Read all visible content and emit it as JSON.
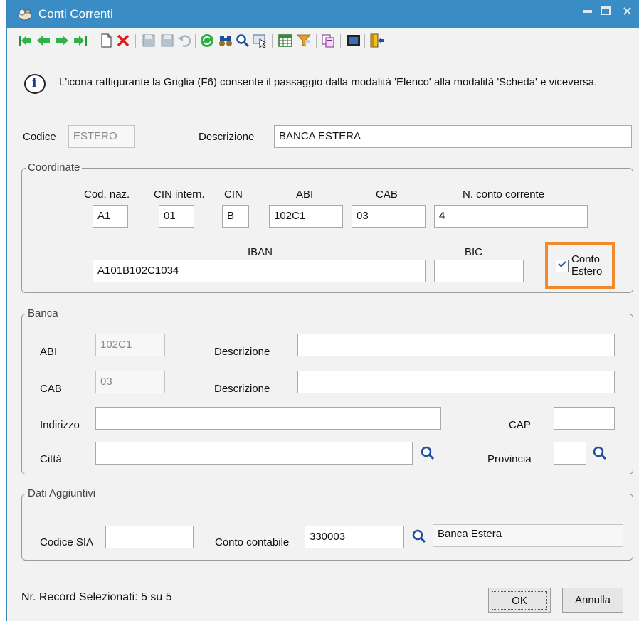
{
  "window": {
    "title": "Conti Correnti"
  },
  "info": {
    "text": "L'icona raffigurante la Griglia (F6) consente il passaggio dalla modalità 'Elenco' alla modalità 'Scheda' e viceversa."
  },
  "header": {
    "codice_label": "Codice",
    "codice_value": "ESTERO",
    "descrizione_label": "Descrizione",
    "descrizione_value": "BANCA ESTERA"
  },
  "coordinate": {
    "title": "Coordinate",
    "cod_naz_label": "Cod. naz.",
    "cod_naz_value": "A1",
    "cin_intern_label": "CIN intern.",
    "cin_intern_value": "01",
    "cin_label": "CIN",
    "cin_value": "B",
    "abi_label": "ABI",
    "abi_value": "102C1",
    "cab_label": "CAB",
    "cab_value": "03",
    "conto_label": "N. conto corrente",
    "conto_value": "4",
    "iban_label": "IBAN",
    "iban_value": "A101B102C1034",
    "bic_label": "BIC",
    "bic_value": "",
    "conto_estero_line1": "Conto",
    "conto_estero_line2": "Estero",
    "conto_estero_checked": true
  },
  "banca": {
    "title": "Banca",
    "abi_label": "ABI",
    "abi_value": "102C1",
    "abi_desc_label": "Descrizione",
    "abi_desc_value": "",
    "cab_label": "CAB",
    "cab_value": "03",
    "cab_desc_label": "Descrizione",
    "cab_desc_value": "",
    "indirizzo_label": "Indirizzo",
    "indirizzo_value": "",
    "cap_label": "CAP",
    "cap_value": "",
    "citta_label": "Città",
    "citta_value": "",
    "provincia_label": "Provincia",
    "provincia_value": ""
  },
  "aggiuntivi": {
    "title": "Dati Aggiuntivi",
    "sia_label": "Codice SIA",
    "sia_value": "",
    "conto_label": "Conto contabile",
    "conto_value": "330003",
    "conto_desc_value": "Banca Estera"
  },
  "footer": {
    "status": "Nr. Record Selezionati: 5 su 5",
    "ok_label": "OK",
    "annulla_label": "Annulla"
  },
  "colors": {
    "titlebar": "#3a8cc4",
    "highlight": "#f08a2a"
  },
  "toolbar_icons": [
    "first-record-icon",
    "previous-record-icon",
    "next-record-icon",
    "last-record-icon",
    "new-record-icon",
    "delete-record-icon",
    "save-icon",
    "save-as-icon",
    "undo-icon",
    "refresh-icon",
    "binoculars-icon",
    "search-icon",
    "select-icon",
    "grid-icon",
    "filter-icon",
    "copy-icon",
    "preview-icon",
    "exit-icon"
  ]
}
